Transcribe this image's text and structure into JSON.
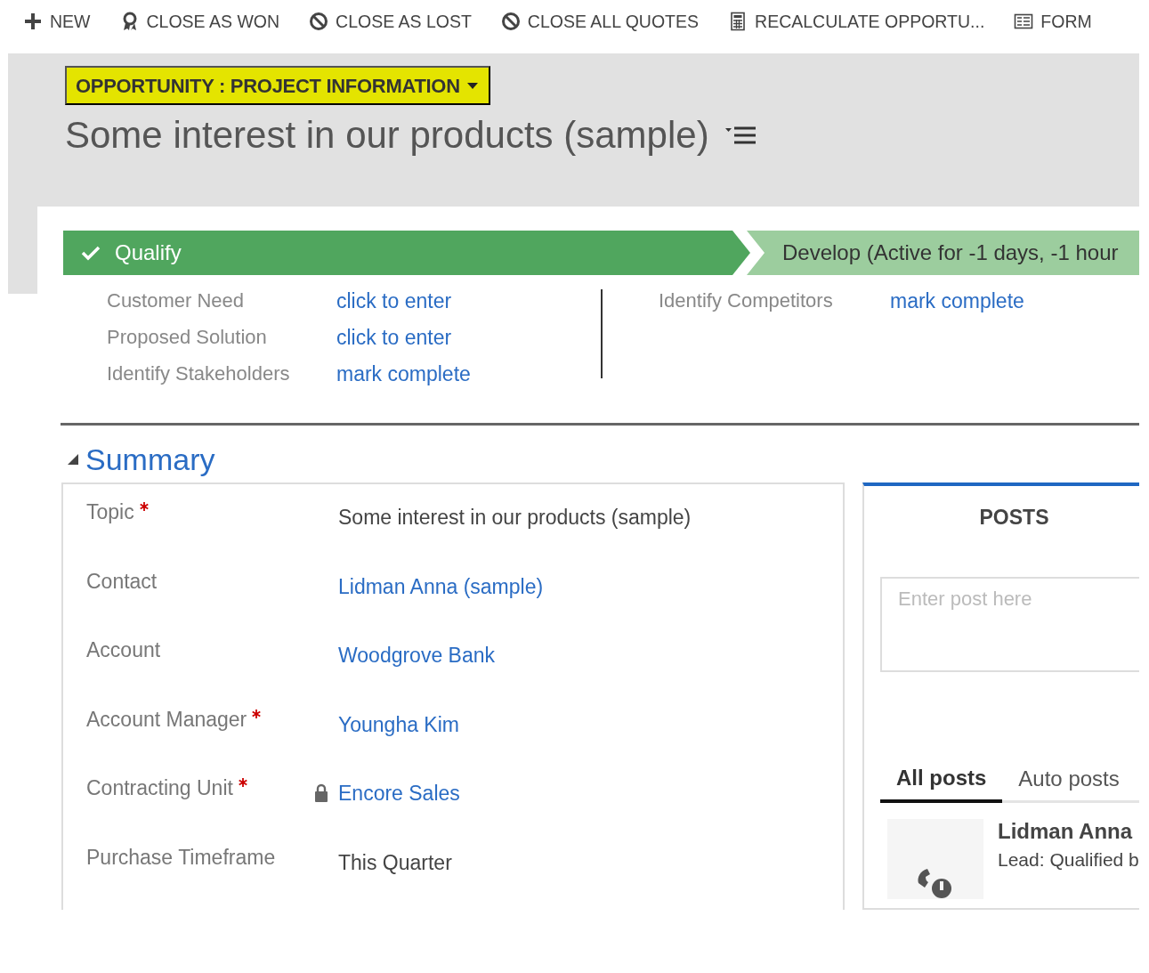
{
  "toolbar": [
    {
      "label": "NEW"
    },
    {
      "label": "CLOSE AS WON"
    },
    {
      "label": "CLOSE AS LOST"
    },
    {
      "label": "CLOSE ALL QUOTES"
    },
    {
      "label": "RECALCULATE OPPORTU..."
    },
    {
      "label": "FORM"
    }
  ],
  "header": {
    "form_selector": "OPPORTUNITY : PROJECT INFORMATION",
    "title": "Some interest in our products (sample)"
  },
  "process": {
    "stages": [
      {
        "label": "Qualify",
        "kind": "completed"
      },
      {
        "label": "Develop (Active for -1 days, -1 hour",
        "kind": "active"
      }
    ],
    "step_columns": [
      [
        {
          "label": "Customer Need",
          "value": "click to enter"
        },
        {
          "label": "Proposed Solution",
          "value": "click to enter"
        },
        {
          "label": "Identify Stakeholders",
          "value": "mark complete"
        }
      ],
      [
        {
          "label": "Identify Competitors",
          "value": "mark complete"
        }
      ]
    ]
  },
  "summary": {
    "title": "Summary",
    "expanded": true,
    "fields": [
      {
        "label": "Topic",
        "required": true,
        "value": "Some interest in our products (sample)",
        "kind": "text",
        "locked": false
      },
      {
        "label": "Contact",
        "required": false,
        "value": "Lidman Anna (sample)",
        "kind": "link",
        "locked": false
      },
      {
        "label": "Account",
        "required": false,
        "value": "Woodgrove Bank",
        "kind": "link",
        "locked": false
      },
      {
        "label": "Account Manager",
        "required": true,
        "value": "Youngha Kim",
        "kind": "link",
        "locked": false
      },
      {
        "label": "Contracting Unit",
        "required": true,
        "value": "Encore Sales",
        "kind": "link",
        "locked": true
      },
      {
        "label": "Purchase Timeframe",
        "required": false,
        "value": "This Quarter",
        "kind": "text",
        "locked": false
      }
    ]
  },
  "posts": {
    "title": "POSTS",
    "placeholder": "Enter post here",
    "tabs": [
      {
        "label": "All posts",
        "selected": true
      },
      {
        "label": "Auto posts",
        "selected": false
      }
    ],
    "items": [
      {
        "author": "Lidman Anna",
        "text": "Lead: Qualified b"
      }
    ]
  }
}
